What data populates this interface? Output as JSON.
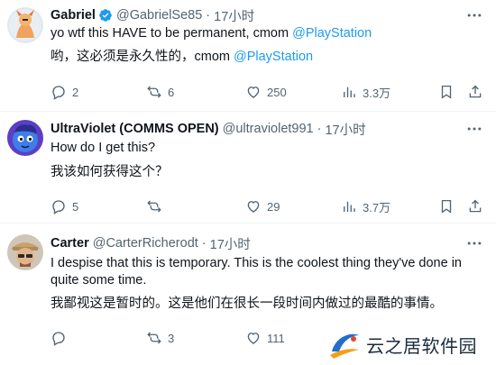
{
  "tweets": [
    {
      "name": "Gabriel",
      "verified": true,
      "handle": "@GabrielSe85",
      "dot": "·",
      "time": "17小时",
      "text_main": "yo wtf this HAVE to be permanent, cmom ",
      "text_mention": "@PlayStation",
      "translation_main": "哟，这必须是永久性的，cmom ",
      "translation_mention": "@PlayStation",
      "replies": "2",
      "retweets": "6",
      "likes": "250",
      "views": "3.3万"
    },
    {
      "name": "UltraViolet (COMMS OPEN)",
      "verified": false,
      "handle": "@ultraviolet991",
      "dot": "·",
      "time": "17小时",
      "text_main": "How do I get this?",
      "translation_main": "我该如何获得这个？",
      "replies": "5",
      "retweets": "",
      "likes": "29",
      "views": "3.7万"
    },
    {
      "name": "Carter",
      "verified": false,
      "handle": "@CarterRicherodt",
      "dot": "·",
      "time": "17小时",
      "text_main": "I despise that this is temporary. This is the coolest thing they've done in quite some time.",
      "translation_main": "我鄙视这是暂时的。这是他们在很长一段时间内做过的最酷的事情。",
      "replies": "",
      "retweets": "3",
      "likes": "111",
      "views": ""
    }
  ],
  "watermark": {
    "text": "云之居软件园"
  },
  "colors": {
    "accent": "#1d9bf0",
    "muted": "#536471",
    "text": "#0f1419",
    "divider": "#eff3f4"
  },
  "icons": [
    "verified-badge-icon",
    "more-icon",
    "reply-icon",
    "retweet-icon",
    "like-icon",
    "views-icon",
    "bookmark-icon",
    "share-icon"
  ]
}
